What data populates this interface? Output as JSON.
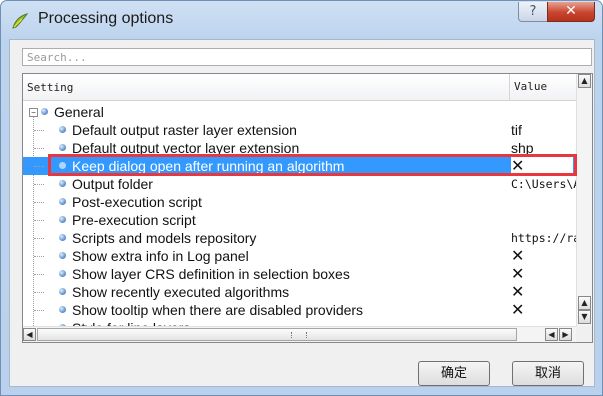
{
  "window": {
    "title": "Processing options",
    "help_glyph": "?",
    "close_glyph": "✕"
  },
  "search": {
    "placeholder": "Search..."
  },
  "table": {
    "headers": [
      "Setting",
      "Value"
    ],
    "group": "General",
    "expander_glyph": "−",
    "rows": [
      {
        "label": "Default output raster layer extension",
        "value": "tif"
      },
      {
        "label": "Default output vector layer extension",
        "value": "shp"
      },
      {
        "label": "Keep dialog open after running an algorithm",
        "value": "✕"
      },
      {
        "label": "Output folder",
        "value": "C:\\Users\\Ad"
      },
      {
        "label": "Post-execution script",
        "value": ""
      },
      {
        "label": "Pre-execution script",
        "value": ""
      },
      {
        "label": "Scripts and models repository",
        "value": "https://rav"
      },
      {
        "label": "Show extra info in Log panel",
        "value": "✕"
      },
      {
        "label": "Show layer CRS definition in selection boxes",
        "value": "✕"
      },
      {
        "label": "Show recently executed algorithms",
        "value": "✕"
      },
      {
        "label": "Show tooltip when there are disabled providers",
        "value": "✕"
      },
      {
        "label": "Style for line layers",
        "value": ""
      }
    ],
    "selected_index": 2
  },
  "scroll": {
    "up": "▲",
    "down": "▼",
    "left": "◀",
    "right": "▶"
  },
  "buttons": {
    "ok": "确定",
    "cancel": "取消"
  },
  "colors": {
    "selection": "#3399ff",
    "highlight_box": "#e8383d"
  }
}
